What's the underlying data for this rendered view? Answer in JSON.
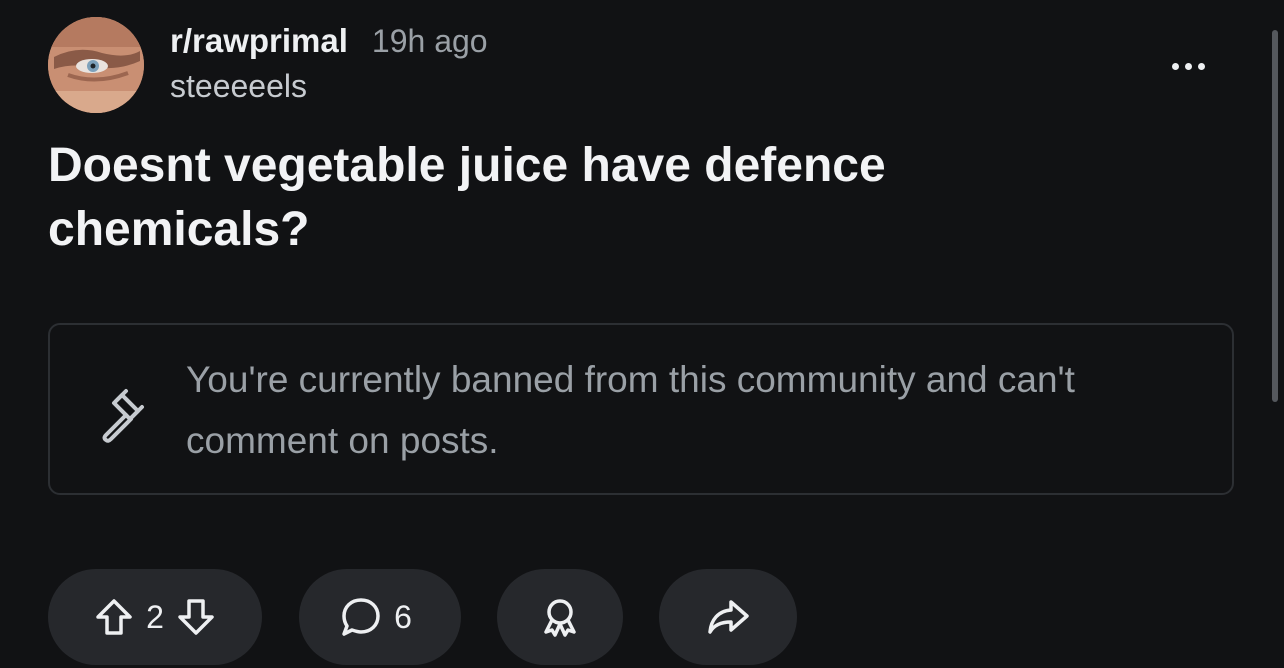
{
  "post": {
    "subreddit": "r/rawprimal",
    "time_ago": "19h ago",
    "author": "steeeeels",
    "title": "Doesnt vegetable juice have defence chemicals?"
  },
  "ban_notice": {
    "icon": "gavel-icon",
    "text": "You're currently banned from this community and can't comment on posts."
  },
  "actions": {
    "vote_count": "2",
    "comment_count": "6",
    "icons": [
      "upvote-icon",
      "downvote-icon",
      "comment-icon",
      "award-icon",
      "share-icon"
    ]
  },
  "colors": {
    "background": "#111214",
    "pill": "#26282c",
    "muted_text": "#9aa0a6",
    "border": "#2c2f33"
  }
}
